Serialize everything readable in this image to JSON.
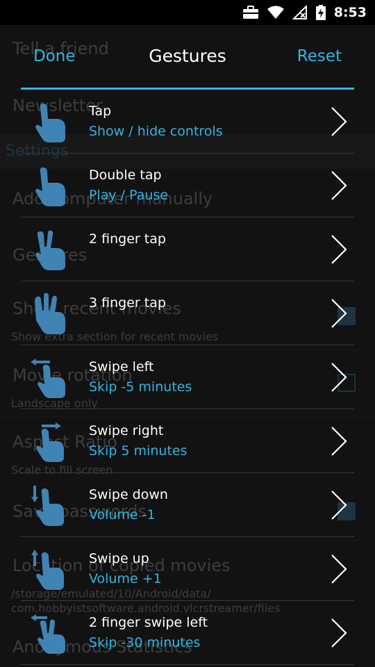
{
  "status_bar": {
    "time": "8:53"
  },
  "background": {
    "items": [
      {
        "title": "Tell a friend"
      },
      {
        "title": "Newsletter"
      },
      {
        "title": "Add computer manually"
      },
      {
        "title": "Gestures"
      },
      {
        "title": "Show recent movies",
        "summary": "Show extra section for recent movies",
        "checked": true
      },
      {
        "title": "Movie rotation",
        "summary": "Landscape only",
        "checked": false
      },
      {
        "title": "Aspect Ratio",
        "summary": "Scale to fill screen"
      },
      {
        "title": "Save passwords",
        "checked": true
      },
      {
        "title": "Location of copied movies",
        "summary_lines": [
          "/storage/emulated/10/Android/data/",
          "com.hobbyistsoftware.android.vlcrstreamer/files"
        ]
      },
      {
        "title": "Anonymous Statistics"
      }
    ],
    "section_header": "Settings"
  },
  "dialog": {
    "done_label": "Done",
    "title": "Gestures",
    "reset_label": "Reset",
    "gestures": [
      {
        "label": "Tap",
        "action": "Show / hide controls",
        "icon": "one-finger-tap-icon"
      },
      {
        "label": "Double tap",
        "action": "Play / Pause",
        "icon": "double-tap-icon"
      },
      {
        "label": "2 finger tap",
        "action": "",
        "icon": "two-finger-tap-icon"
      },
      {
        "label": "3 finger tap",
        "action": "",
        "icon": "three-finger-tap-icon"
      },
      {
        "label": "Swipe left",
        "action": "Skip -5 minutes",
        "icon": "swipe-left-icon"
      },
      {
        "label": "Swipe right",
        "action": "Skip 5 minutes",
        "icon": "swipe-right-icon"
      },
      {
        "label": "Swipe down",
        "action": "Volume -1",
        "icon": "swipe-down-icon"
      },
      {
        "label": "Swipe up",
        "action": "Volume +1",
        "icon": "swipe-up-icon"
      },
      {
        "label": "2 finger swipe left",
        "action": "Skip -30 minutes",
        "icon": "two-finger-swipe-left-icon"
      }
    ]
  },
  "colors": {
    "accent": "#33b5e5",
    "background": "#1f1f1f",
    "icon": "#4a8fbf"
  }
}
